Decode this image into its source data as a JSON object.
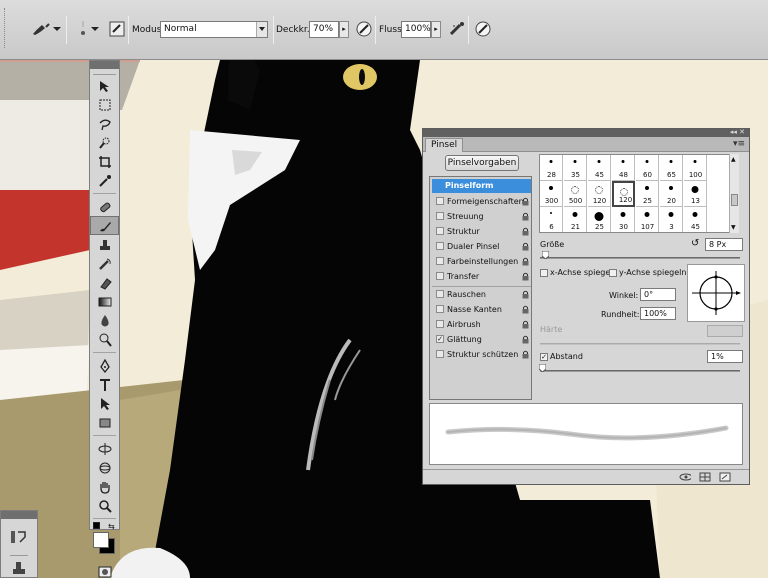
{
  "options_bar": {
    "mode_label": "Modus:",
    "mode_value": "Normal",
    "opacity_label": "Deckkr.:",
    "opacity_value": "70%",
    "flow_label": "Fluss:",
    "flow_value": "100%"
  },
  "tools": [
    "move-icon",
    "marquee-icon",
    "lasso-icon",
    "quick-select-icon",
    "crop-icon",
    "eyedropper-icon",
    "spot-heal-icon",
    "brush-icon",
    "stamp-icon",
    "history-brush-icon",
    "eraser-icon",
    "gradient-icon",
    "blur-icon",
    "dodge-icon",
    "pen-icon",
    "type-icon",
    "path-select-icon",
    "shape-icon",
    "3d-rotate-icon",
    "3d-orbit-icon",
    "hand-icon",
    "zoom-icon"
  ],
  "brush_panel": {
    "tab": "Pinsel",
    "presets_button": "Pinselvorgaben",
    "options": [
      {
        "label": "Pinselform",
        "checked": false,
        "selected": true,
        "header": true,
        "lock": false
      },
      {
        "label": "Formeigenschaften",
        "checked": false,
        "lock": true
      },
      {
        "label": "Streuung",
        "checked": false,
        "lock": true
      },
      {
        "label": "Struktur",
        "checked": false,
        "lock": true
      },
      {
        "label": "Dualer Pinsel",
        "checked": false,
        "lock": true
      },
      {
        "label": "Farbeinstellungen",
        "checked": false,
        "lock": true
      },
      {
        "label": "Transfer",
        "checked": false,
        "lock": true
      },
      {
        "label": "Rauschen",
        "checked": false,
        "lock": true
      },
      {
        "label": "Nasse Kanten",
        "checked": false,
        "lock": true
      },
      {
        "label": "Airbrush",
        "checked": false,
        "lock": true
      },
      {
        "label": "Glättung",
        "checked": true,
        "lock": true
      },
      {
        "label": "Struktur schützen",
        "checked": false,
        "lock": true
      }
    ],
    "preset_rows": [
      [
        "28",
        "35",
        "45",
        "48",
        "60",
        "65",
        "100"
      ],
      [
        "300",
        "500",
        "120",
        "120",
        "25",
        "20",
        "13"
      ],
      [
        "6",
        "21",
        "25",
        "30",
        "107",
        "3",
        "45"
      ]
    ],
    "size_label": "Größe",
    "size_value": "8 Px",
    "flip_x_label": "x-Achse spiegeln",
    "flip_y_label": "y-Achse spiegeln",
    "angle_label": "Winkel:",
    "angle_value": "0°",
    "roundness_label": "Rundheit:",
    "roundness_value": "100%",
    "hardness_label": "Härte",
    "spacing_label": "Abstand",
    "spacing_checked": true,
    "spacing_value": "1%"
  }
}
